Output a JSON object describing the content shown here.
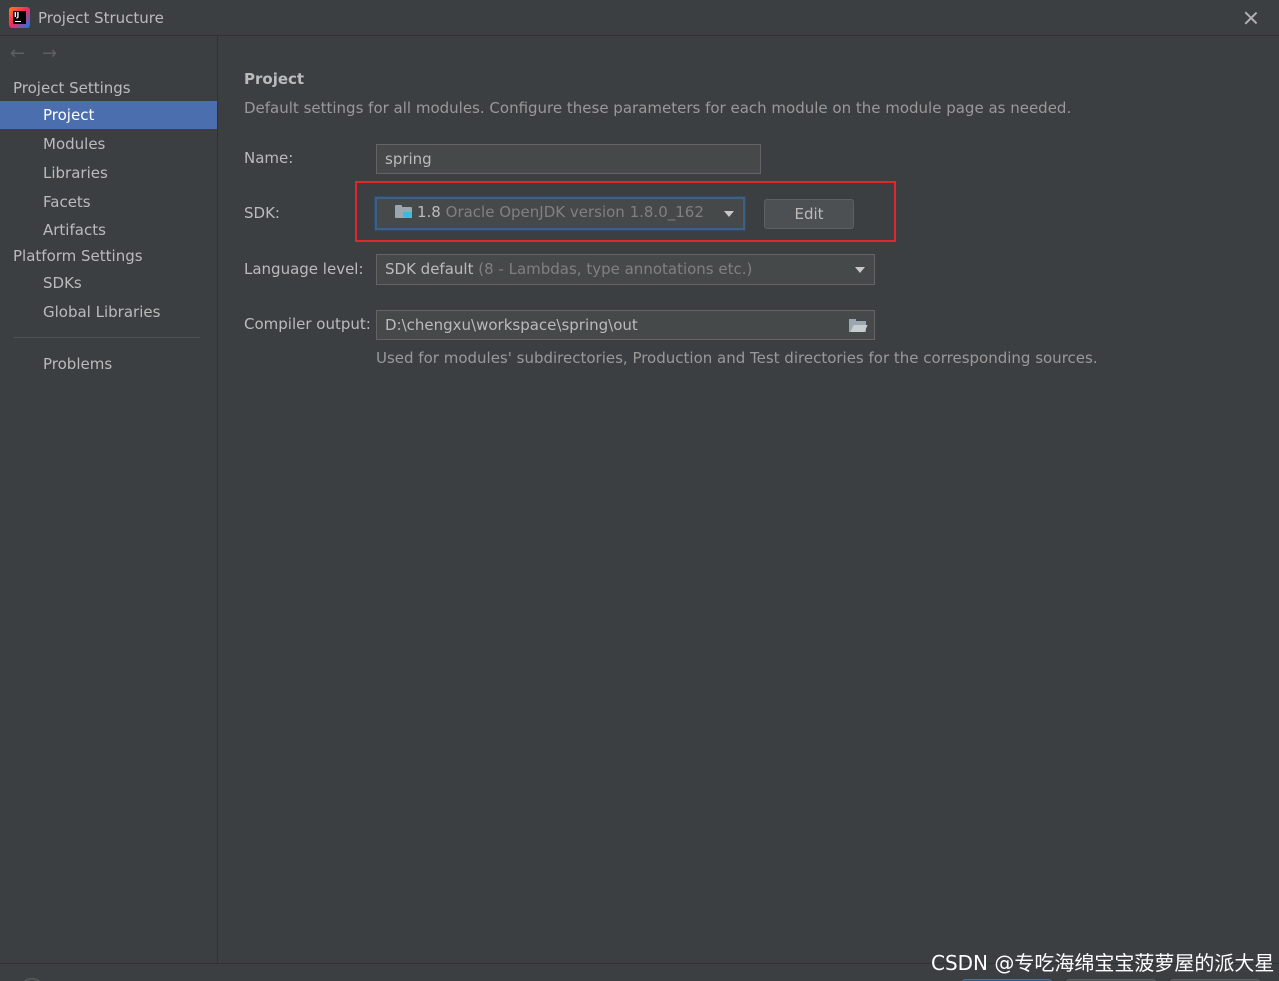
{
  "window": {
    "title": "Project Structure"
  },
  "sidebar": {
    "project_settings_header": "Project Settings",
    "platform_settings_header": "Platform Settings",
    "items": {
      "project": "Project",
      "modules": "Modules",
      "libraries": "Libraries",
      "facets": "Facets",
      "artifacts": "Artifacts",
      "sdks": "SDKs",
      "global_libraries": "Global Libraries",
      "problems": "Problems"
    },
    "selected": "Project"
  },
  "main": {
    "title": "Project",
    "description": "Default settings for all modules. Configure these parameters for each module on the module page as needed.",
    "name_label": "Name:",
    "name_value": "spring",
    "sdk_label": "SDK:",
    "sdk_version": "1.8",
    "sdk_detail": "Oracle OpenJDK version 1.8.0_162",
    "sdk_icon": "jdk-folder-icon",
    "edit_label": "Edit",
    "language_level_label": "Language level:",
    "language_level_value": "SDK default",
    "language_level_detail": "(8 - Lambdas, type annotations etc.)",
    "compiler_output_label": "Compiler output:",
    "compiler_output_value": "D:\\chengxu\\workspace\\spring\\out",
    "compiler_output_hint": "Used for modules' subdirectories, Production and Test directories for the corresponding sources."
  },
  "watermark": "CSDN @专吃海绵宝宝菠萝屋的派大星",
  "colors": {
    "background": "#3c3f41",
    "selection": "#4b6eaf",
    "highlight_box": "#e0262f",
    "focus_border": "#3d6185"
  }
}
